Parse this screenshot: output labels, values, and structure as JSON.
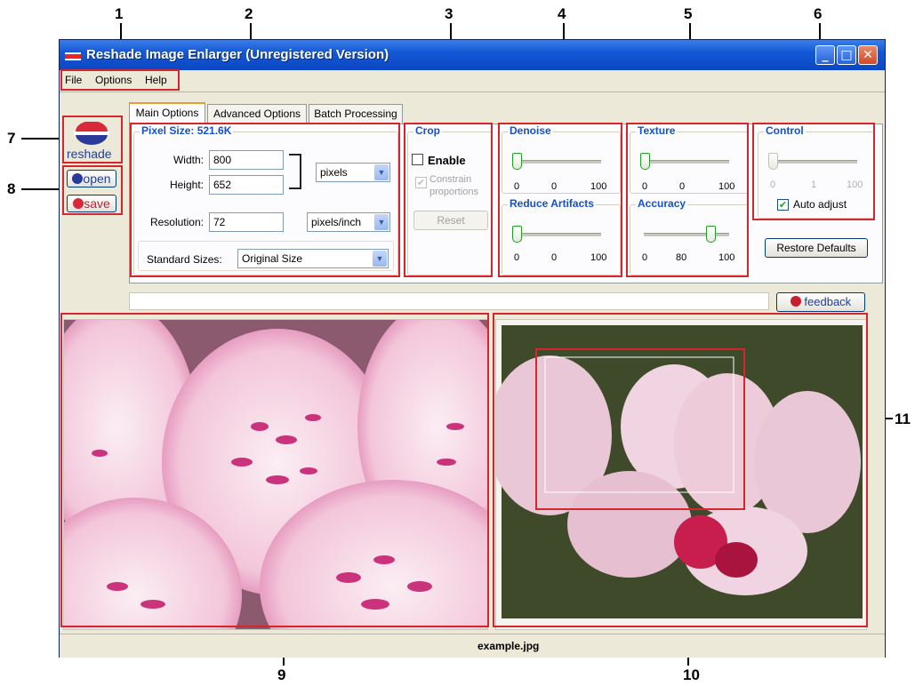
{
  "window": {
    "title": "Reshade Image Enlarger (Unregistered Version)",
    "minimize": "_",
    "maximize": "□",
    "close": "✕"
  },
  "menu": [
    "File",
    "Options",
    "Help"
  ],
  "sidebar": {
    "logo_text": "reshade",
    "open_label": "open",
    "save_label": "save"
  },
  "tabs": [
    "Main Options",
    "Advanced Options",
    "Batch Processing"
  ],
  "pixel_size": {
    "title": "Pixel Size: 521.6K",
    "width_label": "Width:",
    "width_value": "800",
    "height_label": "Height:",
    "height_value": "652",
    "unit": "pixels",
    "resolution_label": "Resolution:",
    "resolution_value": "72",
    "resolution_unit": "pixels/inch",
    "standard_sizes_label": "Standard Sizes:",
    "standard_sizes_value": "Original Size"
  },
  "crop": {
    "title": "Crop",
    "enable_label": "Enable",
    "constrain_label": "Constrain\nproportions",
    "reset_label": "Reset"
  },
  "denoise": {
    "title": "Denoise",
    "min": "0",
    "value": "0",
    "max": "100"
  },
  "reduce_artifacts": {
    "title": "Reduce Artifacts",
    "min": "0",
    "value": "0",
    "max": "100"
  },
  "texture": {
    "title": "Texture",
    "min": "0",
    "value": "0",
    "max": "100"
  },
  "accuracy": {
    "title": "Accuracy",
    "min": "0",
    "value": "80",
    "max": "100"
  },
  "control": {
    "title": "Control",
    "min": "0",
    "value": "1",
    "max": "100",
    "auto_adjust_label": "Auto adjust",
    "auto_adjust_checked": true
  },
  "restore_defaults_label": "Restore Defaults",
  "feedback_label": "feedback",
  "status": {
    "filename": "example.jpg"
  },
  "callouts": [
    "1",
    "2",
    "3",
    "4",
    "5",
    "6",
    "7",
    "8",
    "9",
    "10",
    "11"
  ],
  "colors": {
    "callout_red": "#d4262b",
    "title_blue": "#1458d6",
    "group_title": "#1450c8",
    "slider_green": "#21a121"
  }
}
